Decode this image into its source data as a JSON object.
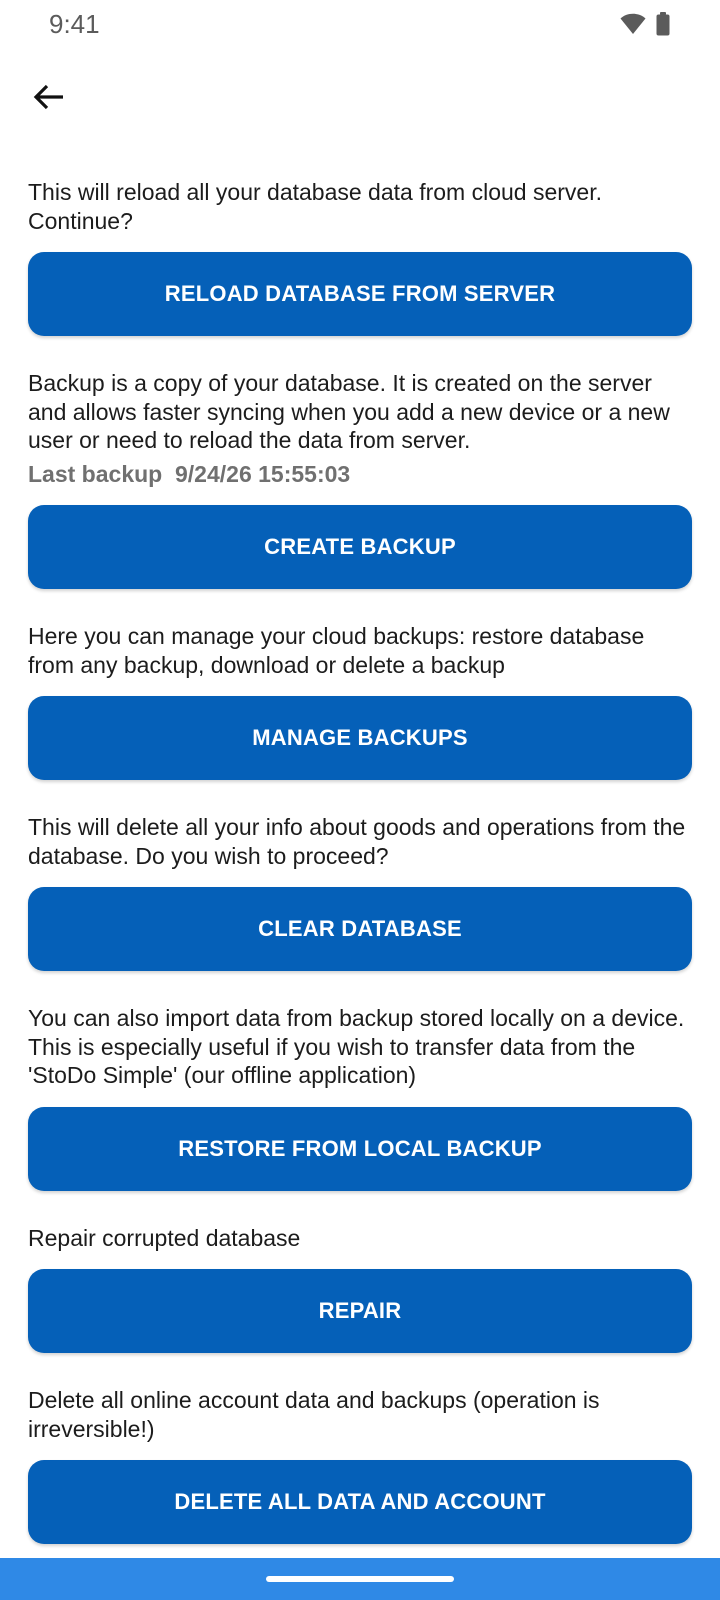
{
  "status_bar": {
    "time": "9:41",
    "icons": [
      "wifi-icon",
      "battery-icon"
    ]
  },
  "header": {
    "back_icon": "arrow-left-icon"
  },
  "sections": [
    {
      "description": "This will reload all your database data from cloud server. Continue?",
      "button_label": "RELOAD DATABASE FROM SERVER"
    },
    {
      "description": "Backup is a copy of your database. It is created on the server and allows faster syncing when you add a new device or a new user or need to reload the data from server.",
      "last_backup_label": "Last backup",
      "last_backup_value": "9/24/26 15:55:03",
      "button_label": "CREATE BACKUP"
    },
    {
      "description": "Here you can manage your cloud backups: restore database from any backup, download or delete a backup",
      "button_label": "MANAGE BACKUPS"
    },
    {
      "description": "This will delete all your info about goods and operations from the database. Do you wish to proceed?",
      "button_label": "CLEAR DATABASE"
    },
    {
      "description": "You can also import data from backup stored locally on a device. This is especially useful if you wish to transfer data from the 'StoDo Simple' (our offline application)",
      "button_label": "RESTORE FROM LOCAL BACKUP"
    },
    {
      "description": "Repair corrupted database",
      "button_label": "REPAIR"
    },
    {
      "description": "Delete all online account data and backups (operation is irreversible!)",
      "button_label": "DELETE ALL DATA AND ACCOUNT"
    }
  ],
  "colors": {
    "button_bg": "#0560b8",
    "button_text": "#ffffff",
    "nav_bar": "#2f89e6",
    "last_backup_text": "#707070"
  }
}
